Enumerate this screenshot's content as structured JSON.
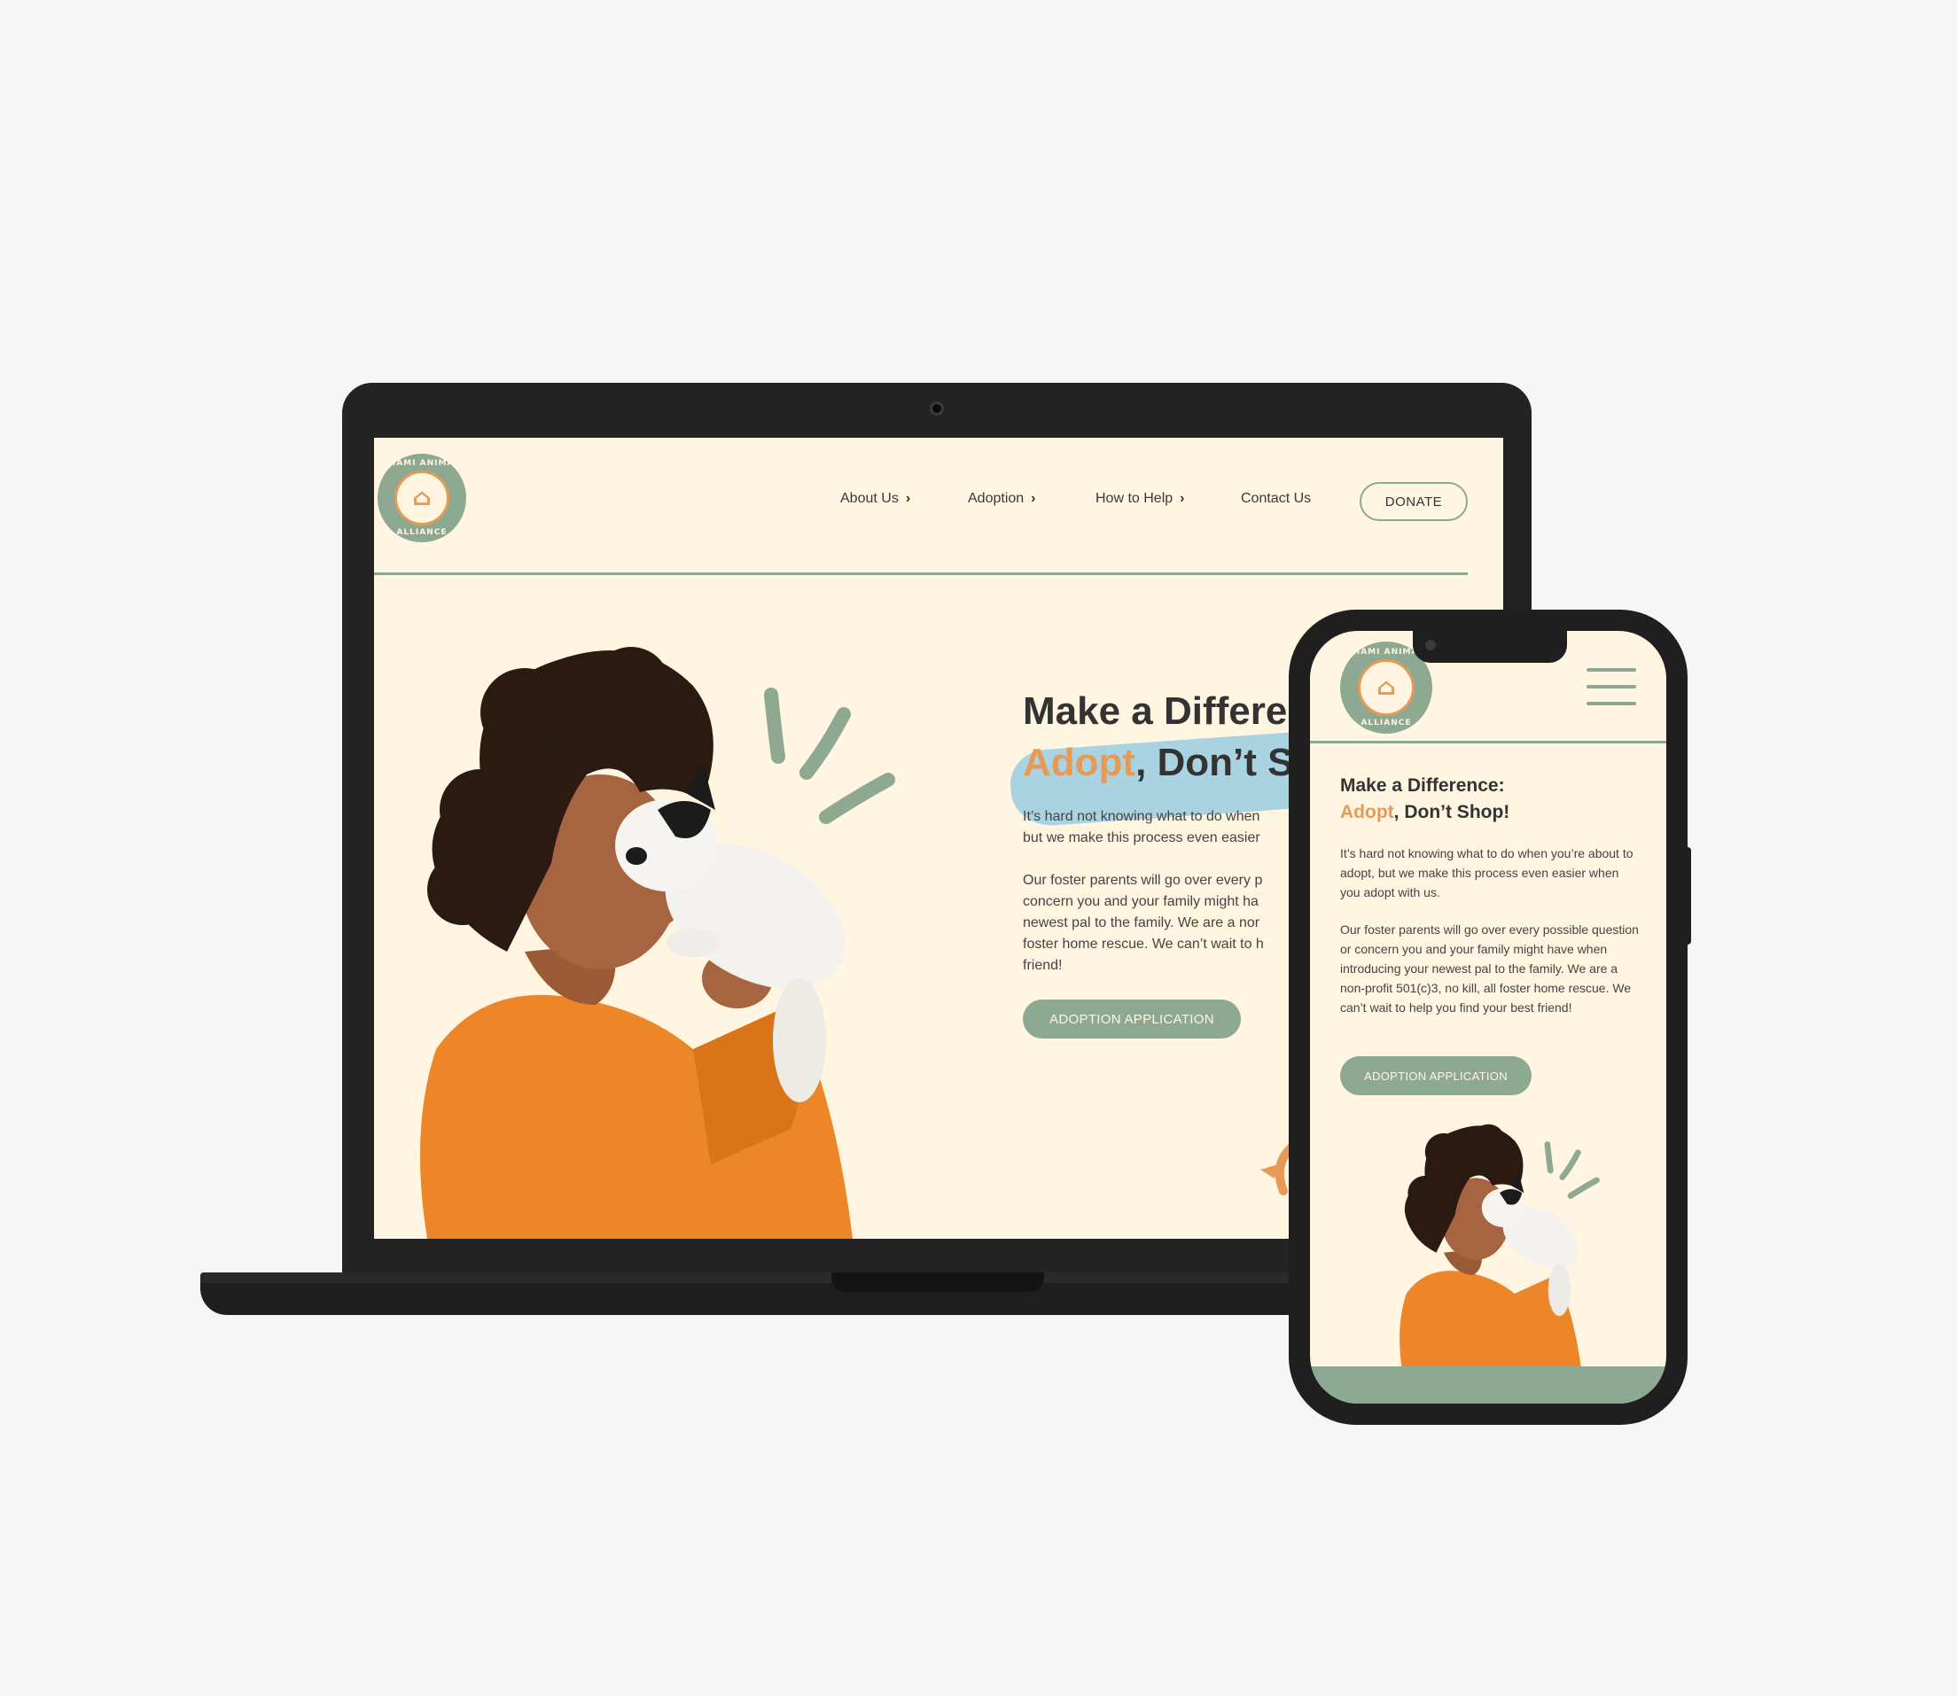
{
  "colors": {
    "cream": "#fff5e1",
    "sage": "#8ea991",
    "orange": "#e79a55",
    "sky": "#a9d3e0",
    "text": "#333333"
  },
  "brand": {
    "ring_top": "MIAMI ANIMAL",
    "ring_bottom": "ALLIANCE",
    "mark": "⌂"
  },
  "nav": {
    "items": [
      {
        "label": "About Us",
        "has_chevron": true
      },
      {
        "label": "Adoption",
        "has_chevron": true
      },
      {
        "label": "How to Help",
        "has_chevron": true
      },
      {
        "label": "Contact Us",
        "has_chevron": false
      }
    ],
    "chevron": "›",
    "donate_label": "DONATE"
  },
  "desktop": {
    "heading_line1": "Make a Differe",
    "heading_accent": "Adopt",
    "heading_line2_rest": ", Don’t S",
    "para1_line1": "It’s hard not knowing what to do when",
    "para1_line2": "but we make this process even easier",
    "para2_lines": [
      "Our foster parents will go over every p",
      "concern you and your family might ha",
      "newest pal to the family. We are a nor",
      "foster home rescue. We can’t wait to h",
      "friend!"
    ],
    "button_label": "ADOPTION APPLICATION"
  },
  "mobile": {
    "heading_line1": "Make a Difference:",
    "heading_accent": "Adopt",
    "heading_line2_rest": ", Don’t Shop!",
    "para1": "It’s hard not knowing what to do when you’re about to adopt, but we make this process even easier when you adopt with us.",
    "para2": "Our foster parents will go over every possible question or concern you and your family might have when introducing your newest pal to the family. We are a non-profit 501(c)3, no kill, all foster home rescue. We can’t wait to help you find your best friend!",
    "button_label": "ADOPTION APPLICATION"
  }
}
